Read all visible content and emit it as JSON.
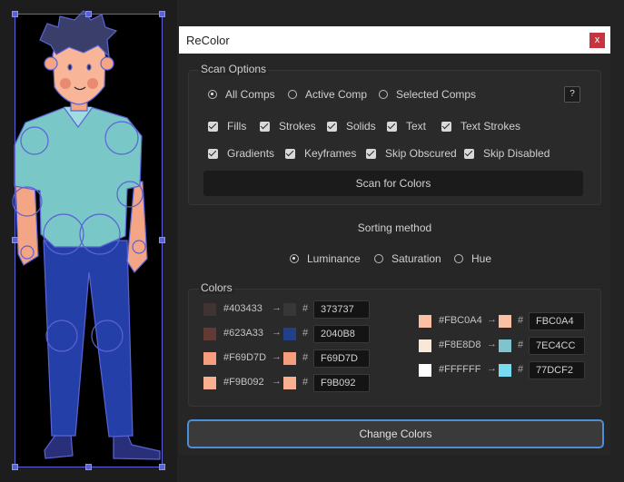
{
  "panel": {
    "title": "ReColor",
    "close_label": "x"
  },
  "scan_options": {
    "title": "Scan Options",
    "scope": [
      {
        "label": "All Comps",
        "selected": true
      },
      {
        "label": "Active Comp",
        "selected": false
      },
      {
        "label": "Selected Comps",
        "selected": false
      }
    ],
    "help_label": "?",
    "checks_row1": [
      "Fills",
      "Strokes",
      "Solids",
      "Text",
      "Text Strokes"
    ],
    "checks_row2": [
      "Gradients",
      "Keyframes",
      "Skip Obscured",
      "Skip Disabled"
    ],
    "scan_button": "Scan for Colors"
  },
  "sorting": {
    "label": "Sorting method",
    "options": [
      {
        "label": "Luminance",
        "selected": true
      },
      {
        "label": "Saturation",
        "selected": false
      },
      {
        "label": "Hue",
        "selected": false
      }
    ]
  },
  "colors": {
    "title": "Colors",
    "left": [
      {
        "from": "#403433",
        "to": "#373737",
        "value": "373737"
      },
      {
        "from": "#623A33",
        "to": "#204088",
        "value": "2040B8"
      },
      {
        "from": "#F69D7D",
        "to": "#F69D7D",
        "value": "F69D7D"
      },
      {
        "from": "#F9B092",
        "to": "#F9B092",
        "value": "F9B092"
      }
    ],
    "right": [
      {
        "from": "#FBC0A4",
        "to": "#FBC0A4",
        "value": "FBC0A4"
      },
      {
        "from": "#F8E8D8",
        "to": "#7EC4CC",
        "value": "7EC4CC"
      },
      {
        "from": "#FFFFFF",
        "to": "#77DCF2",
        "value": "77DCF2"
      }
    ],
    "arrow": "→",
    "hash": "#"
  },
  "change_button": "Change Colors"
}
